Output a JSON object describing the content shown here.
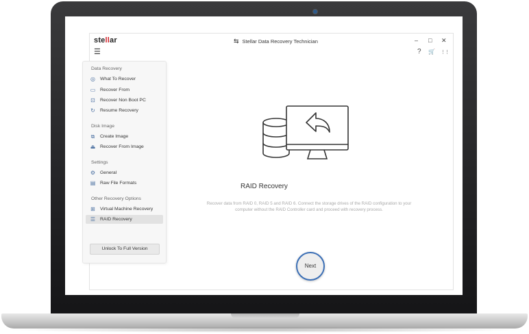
{
  "window": {
    "logo_left": "ste",
    "logo_mid": "ll",
    "logo_right": "ar",
    "title": "Stellar Data Recovery Technician",
    "minimize_glyph": "–",
    "maximize_glyph": "□",
    "close_glyph": "✕"
  },
  "toolbar": {
    "menu_glyph": "☰",
    "help_glyph": "?",
    "cart_glyph": "🛒",
    "apps_glyph": "⋮⋮"
  },
  "sidebar": {
    "sections": [
      {
        "title": "Data Recovery",
        "items": [
          {
            "label": "What To Recover",
            "icon": "target-icon"
          },
          {
            "label": "Recover From",
            "icon": "drive-icon"
          },
          {
            "label": "Recover Non Boot PC",
            "icon": "monitor-icon"
          },
          {
            "label": "Resume Recovery",
            "icon": "resume-icon"
          }
        ]
      },
      {
        "title": "Disk Image",
        "items": [
          {
            "label": "Create Image",
            "icon": "create-image-icon"
          },
          {
            "label": "Recover From Image",
            "icon": "image-icon"
          }
        ]
      },
      {
        "title": "Settings",
        "items": [
          {
            "label": "General",
            "icon": "gear-icon"
          },
          {
            "label": "Raw File Formats",
            "icon": "file-formats-icon"
          }
        ]
      },
      {
        "title": "Other Recovery Options",
        "items": [
          {
            "label": "Virtual Machine Recovery",
            "icon": "vm-icon"
          },
          {
            "label": "RAID Recovery",
            "icon": "database-icon",
            "active": true
          }
        ]
      }
    ],
    "unlock_label": "Unlock To Full Version"
  },
  "main": {
    "title": "RAID Recovery",
    "description": "Recover data from RAID 0, RAID 5 and RAID 6. Connect the storage drives of the RAID configuration to your computer without the RAID Controller card and proceed with recovery process.",
    "next_label": "Next"
  },
  "colors": {
    "accent": "#3b6fb6",
    "brand_red": "#d2232a",
    "laptop_bezel": "#1c1c1e"
  }
}
